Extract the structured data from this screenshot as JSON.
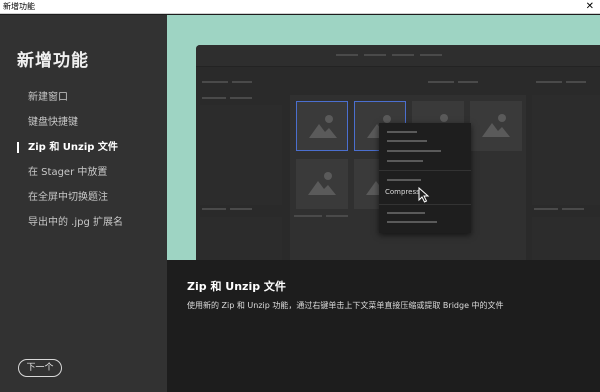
{
  "window": {
    "title": "新增功能",
    "close_glyph": "✕"
  },
  "sidebar": {
    "heading": "新增功能",
    "items": [
      {
        "label": "新建窗口"
      },
      {
        "label": "键盘快捷键"
      },
      {
        "label": "Zip 和 Unzip 文件"
      },
      {
        "label": "在 Stager 中放置"
      },
      {
        "label": "在全屏中切换题注"
      },
      {
        "label": "导出中的 .jpg 扩展名"
      }
    ],
    "active_index": 2,
    "next_label": "下一个"
  },
  "preview": {
    "menu_item": "Compress",
    "accent_bg": "#9ed4c3",
    "selection_color": "#4b6fcf",
    "icons": [
      "image-thumbnail-icon",
      "cursor-arrow-icon"
    ]
  },
  "description": {
    "title": "Zip 和 Unzip 文件",
    "text": "使用新的 Zip 和 Unzip 功能，通过右键单击上下文菜单直接压缩或提取 Bridge 中的文件"
  }
}
